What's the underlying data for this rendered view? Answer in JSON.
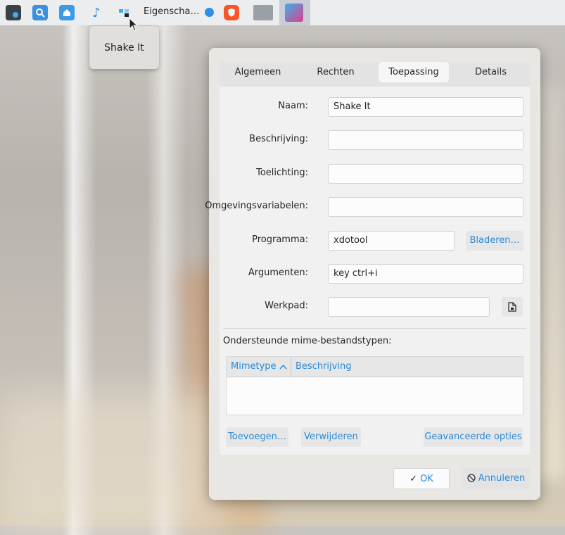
{
  "taskbar": {
    "window_title": "Eigenscha…"
  },
  "tooltip": {
    "text": "Shake It"
  },
  "dialog": {
    "tabs": [
      {
        "label": "Algemeen"
      },
      {
        "label": "Rechten"
      },
      {
        "label": "Toepassing"
      },
      {
        "label": "Details"
      }
    ],
    "fields": {
      "naam_label": "Naam:",
      "naam_value": "Shake It",
      "beschrijving_label": "Beschrijving:",
      "beschrijving_value": "",
      "toelichting_label": "Toelichting:",
      "toelichting_value": "",
      "omgeving_label": "Omgevingsvariabelen:",
      "omgeving_value": "",
      "programma_label": "Programma:",
      "programma_value": "xdotool",
      "argumenten_label": "Argumenten:",
      "argumenten_value": "key ctrl+i",
      "werkpad_label": "Werkpad:",
      "werkpad_value": ""
    },
    "browse_label": "Bladeren…",
    "mime_label": "Ondersteunde mime-bestandstypen:",
    "table_headers": {
      "mimetype": "Mimetype",
      "beschrijving": "Beschrijving"
    },
    "add_label": "Toevoegen…",
    "remove_label": "Verwijderen",
    "advanced_label": "Geavanceerde opties",
    "ok_label": "OK",
    "cancel_label": "Annuleren"
  },
  "colors": {
    "accent": "#2a8ad8",
    "taskbar": "#ecedef"
  }
}
